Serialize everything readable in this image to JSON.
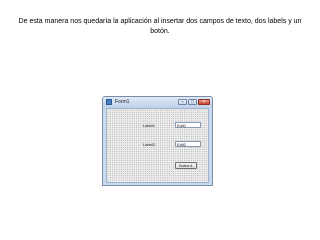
{
  "caption": "De esta manera nos quedaría la aplicación al insertar dos campos de texto, dos labels y un botón.",
  "window": {
    "title": "Form1",
    "icon": "form-icon",
    "controls": {
      "minimize": "–",
      "maximize": "□",
      "close": "×"
    }
  },
  "form": {
    "label1": "Label1",
    "label2": "Label2",
    "edit1": "Edit1",
    "edit2": "Edit2",
    "button1": "Button1"
  }
}
